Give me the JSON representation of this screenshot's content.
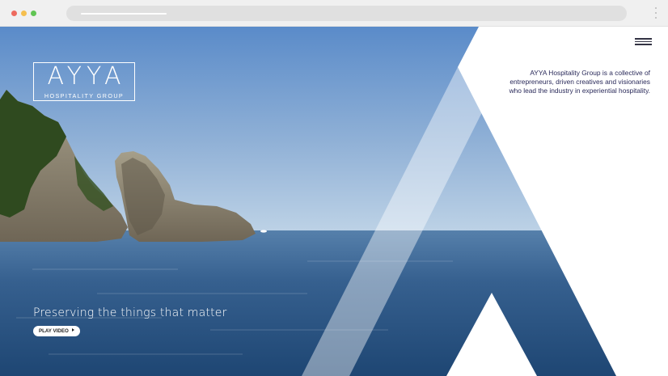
{
  "browser": {
    "controls": [
      "close",
      "minimize",
      "maximize"
    ],
    "colors": {
      "close": "#ed6a5e",
      "minimize": "#f5bf4f",
      "maximize": "#61c554"
    },
    "menu_icon": "kebab-menu-icon"
  },
  "brand": {
    "wordmark": "AYYA",
    "subtitle": "HOSPITALITY GROUP"
  },
  "nav": {
    "menu_icon": "hamburger-menu-icon"
  },
  "intro": {
    "text": "AYYA Hospitality Group is a collective of entrepreneurs, driven creatives and visionaries who lead the industry in experiential hospitality."
  },
  "hero": {
    "tagline": "Preserving the things that matter",
    "play_label": "PLAY VIDEO",
    "play_icon": "play-triangle-icon"
  },
  "colors": {
    "sky_top": "#5a8bc9",
    "sky_horizon": "#bdd2e6",
    "sea_deep": "#1e4673",
    "sea_light": "#5680ab",
    "panel": "#ffffff",
    "intro_text": "#2a2a5a"
  }
}
